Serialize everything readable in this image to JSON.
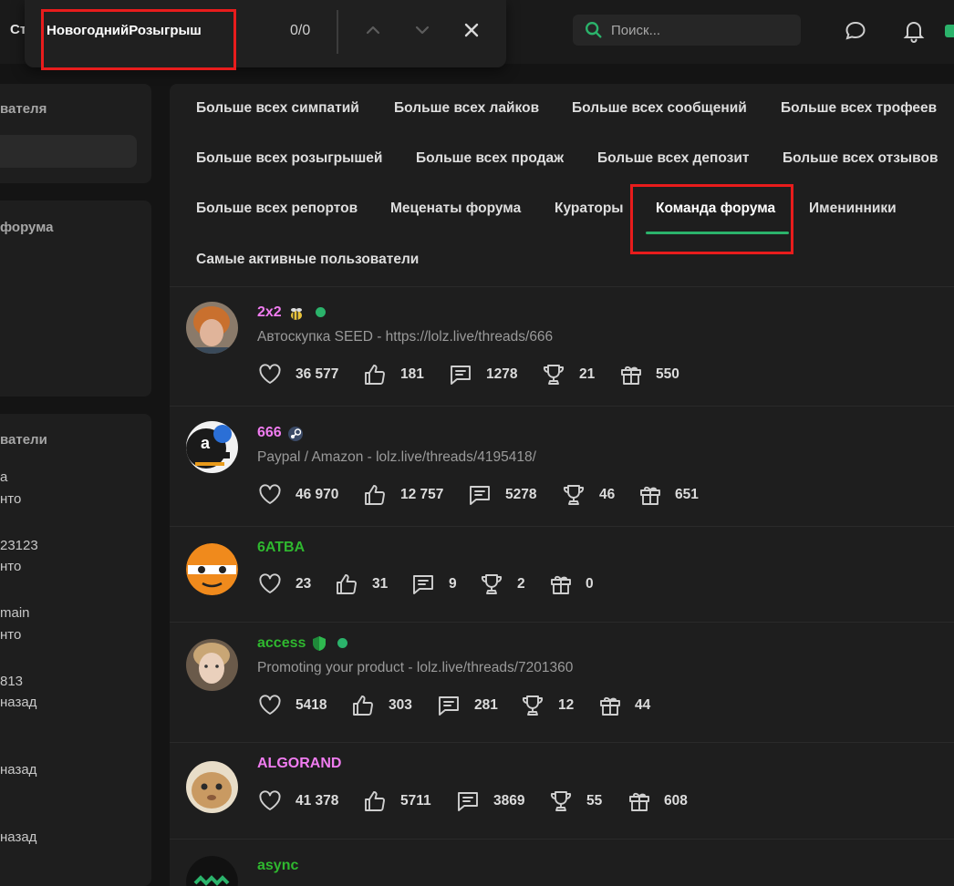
{
  "topbar": {
    "left_text": "Ст",
    "search_placeholder": "Поиск..."
  },
  "find": {
    "query": "НовогоднийРозыгрыш",
    "count": "0/0"
  },
  "sidebar": {
    "card1_title": "вателя",
    "card2_title": "форума",
    "card3_title": "ватели",
    "lines": [
      "а",
      "нто",
      "23123",
      "нто",
      "main",
      "нто",
      "813",
      "назад",
      "назад",
      "назад"
    ]
  },
  "tabs": [
    "Больше всех симпатий",
    "Больше всех лайков",
    "Больше всех сообщений",
    "Больше всех трофеев",
    "Больше всех розыгрышей",
    "Больше всех продаж",
    "Больше всех депозит",
    "Больше всех отзывов",
    "Больше всех репортов",
    "Меценаты форума",
    "Кураторы",
    "Команда форума",
    "Именинники",
    "Самые активные пользователи"
  ],
  "active_tab": "Команда форума",
  "users": [
    {
      "name": "2x2",
      "name_color": "#f07cf0",
      "status": "Автоскупка SEED - https://lolz.live/threads/666",
      "online": true,
      "badge": "bee-icon",
      "stats": [
        "36 577",
        "181",
        "1278",
        "21",
        "550"
      ]
    },
    {
      "name": "666",
      "name_color": "#f07cf0",
      "status": "Paypal / Amazon - lolz.live/threads/4195418/",
      "online": false,
      "badge": "steam-icon",
      "stats": [
        "46 970",
        "12 757",
        "5278",
        "46",
        "651"
      ]
    },
    {
      "name": "6ATBA",
      "name_color": "#2fb82f",
      "status": "",
      "online": false,
      "badge": "",
      "stats": [
        "23",
        "31",
        "9",
        "2",
        "0"
      ]
    },
    {
      "name": "access",
      "name_color": "#2fb82f",
      "status": "Promoting your product - lolz.live/threads/7201360",
      "online": true,
      "badge": "shield-icon",
      "stats": [
        "5418",
        "303",
        "281",
        "12",
        "44"
      ]
    },
    {
      "name": "ALGORAND",
      "name_color": "#f07cf0",
      "status": "",
      "online": false,
      "badge": "",
      "stats": [
        "41 378",
        "5711",
        "3869",
        "55",
        "608"
      ]
    },
    {
      "name": "async",
      "name_color": "#2fb82f",
      "status": "",
      "online": false,
      "badge": "",
      "stats": []
    }
  ],
  "stat_icons": [
    "heart-icon",
    "thumbs-up-icon",
    "message-icon",
    "trophy-icon",
    "gift-icon"
  ],
  "colors": {
    "accent": "#2bb36b",
    "highlight": "#e81c1c"
  }
}
